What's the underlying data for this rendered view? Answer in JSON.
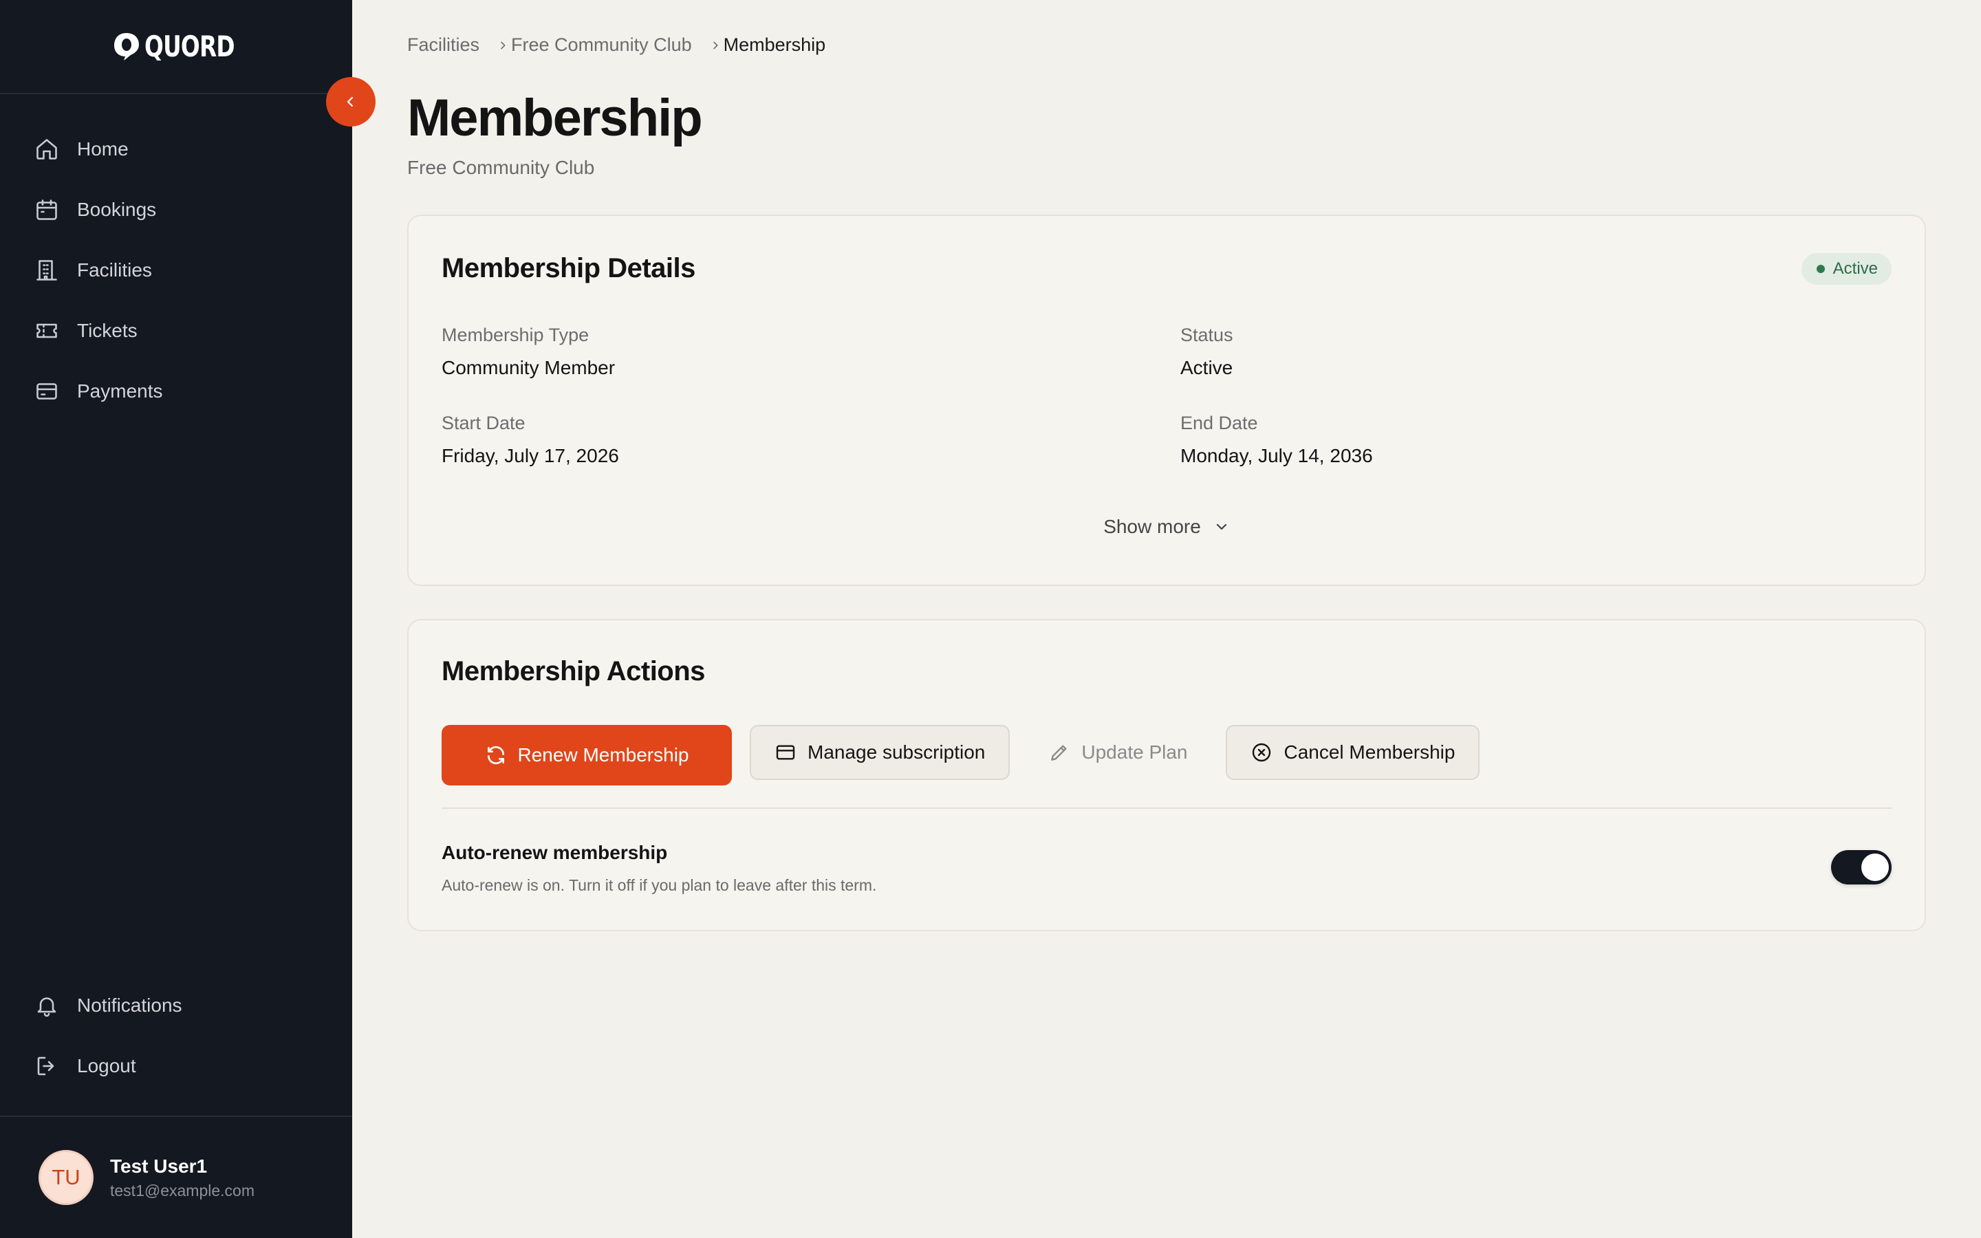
{
  "app": {
    "logo_text": "QUORD"
  },
  "colors": {
    "accent": "#e0461a",
    "sidebar_bg": "#141820",
    "page_bg": "#f3f1ec",
    "active_green": "#2e7a4e"
  },
  "sidebar": {
    "items": [
      {
        "label": "Home",
        "icon": "home-icon"
      },
      {
        "label": "Bookings",
        "icon": "calendar-icon"
      },
      {
        "label": "Facilities",
        "icon": "building-icon"
      },
      {
        "label": "Tickets",
        "icon": "ticket-icon"
      },
      {
        "label": "Payments",
        "icon": "credit-card-icon"
      }
    ],
    "bottom_items": [
      {
        "label": "Notifications",
        "icon": "bell-icon"
      },
      {
        "label": "Logout",
        "icon": "logout-icon"
      }
    ],
    "user": {
      "initials": "TU",
      "name": "Test User1",
      "email": "test1@example.com"
    }
  },
  "breadcrumb": [
    "Facilities",
    "Free Community Club",
    "Membership"
  ],
  "page": {
    "title": "Membership",
    "subtitle": "Free Community Club"
  },
  "details": {
    "title": "Membership Details",
    "badge": "Active",
    "fields": [
      {
        "label": "Membership Type",
        "value": "Community Member"
      },
      {
        "label": "Status",
        "value": "Active"
      },
      {
        "label": "Start Date",
        "value": "Friday, July 17, 2026"
      },
      {
        "label": "End Date",
        "value": "Monday, July 14, 2036"
      }
    ],
    "show_more": "Show more"
  },
  "actions": {
    "title": "Membership Actions",
    "renew": "Renew Membership",
    "manage": "Manage subscription",
    "update": "Update Plan",
    "cancel": "Cancel Membership",
    "auto_renew_title": "Auto-renew membership",
    "auto_renew_desc": "Auto-renew is on. Turn it off if you plan to leave after this term.",
    "auto_renew_on": true
  }
}
